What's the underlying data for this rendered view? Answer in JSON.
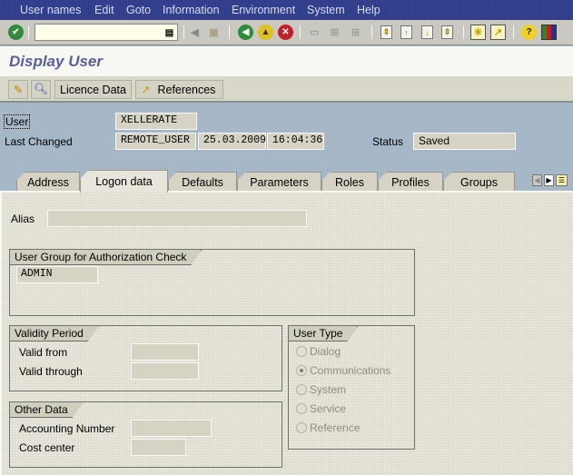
{
  "menubar": {
    "items": [
      "User names",
      "Edit",
      "Goto",
      "Information",
      "Environment",
      "System",
      "Help"
    ]
  },
  "toolbar": {
    "command_field_value": "",
    "icons": [
      "enter-icon",
      "command-history-icon",
      "back-arrow-icon",
      "save-icon",
      "back-icon",
      "exit-icon",
      "cancel-icon",
      "print-icon",
      "find-icon",
      "find-next-icon",
      "first-page-icon",
      "previous-page-icon",
      "next-page-icon",
      "last-page-icon",
      "new-session-icon",
      "shortcut-icon",
      "help-icon",
      "layout-menu-icon"
    ]
  },
  "title": "Display User",
  "app_toolbar": {
    "change_icon": "pencil-glasses-icon",
    "other_user_icon": "magnifier-icon",
    "licence_label": "Licence Data",
    "references_label": "References"
  },
  "header": {
    "user_label": "User",
    "user_value": "XELLERATE",
    "last_changed_label": "Last Changed",
    "changed_by": "REMOTE_USER",
    "changed_date": "25.03.2009",
    "changed_time": "16:04:36",
    "status_label": "Status",
    "status_value": "Saved"
  },
  "tabs": [
    {
      "label": "Address",
      "active": false
    },
    {
      "label": "Logon data",
      "active": true
    },
    {
      "label": "Defaults",
      "active": false
    },
    {
      "label": "Parameters",
      "active": false
    },
    {
      "label": "Roles",
      "active": false
    },
    {
      "label": "Profiles",
      "active": false
    },
    {
      "label": "Groups",
      "active": false
    }
  ],
  "logon": {
    "alias_label": "Alias",
    "alias_value": "",
    "user_group": {
      "title": "User Group for Authorization Check",
      "value": "ADMIN"
    },
    "validity": {
      "title": "Validity Period",
      "valid_from_label": "Valid from",
      "valid_from_value": "",
      "valid_through_label": "Valid through",
      "valid_through_value": ""
    },
    "other": {
      "title": "Other Data",
      "accounting_label": "Accounting Number",
      "accounting_value": "",
      "cost_center_label": "Cost center",
      "cost_center_value": ""
    },
    "user_type": {
      "title": "User Type",
      "options": [
        {
          "label": "Dialog",
          "selected": false
        },
        {
          "label": "Communications",
          "selected": true
        },
        {
          "label": "System",
          "selected": false
        },
        {
          "label": "Service",
          "selected": false
        },
        {
          "label": "Reference",
          "selected": false
        }
      ]
    }
  }
}
